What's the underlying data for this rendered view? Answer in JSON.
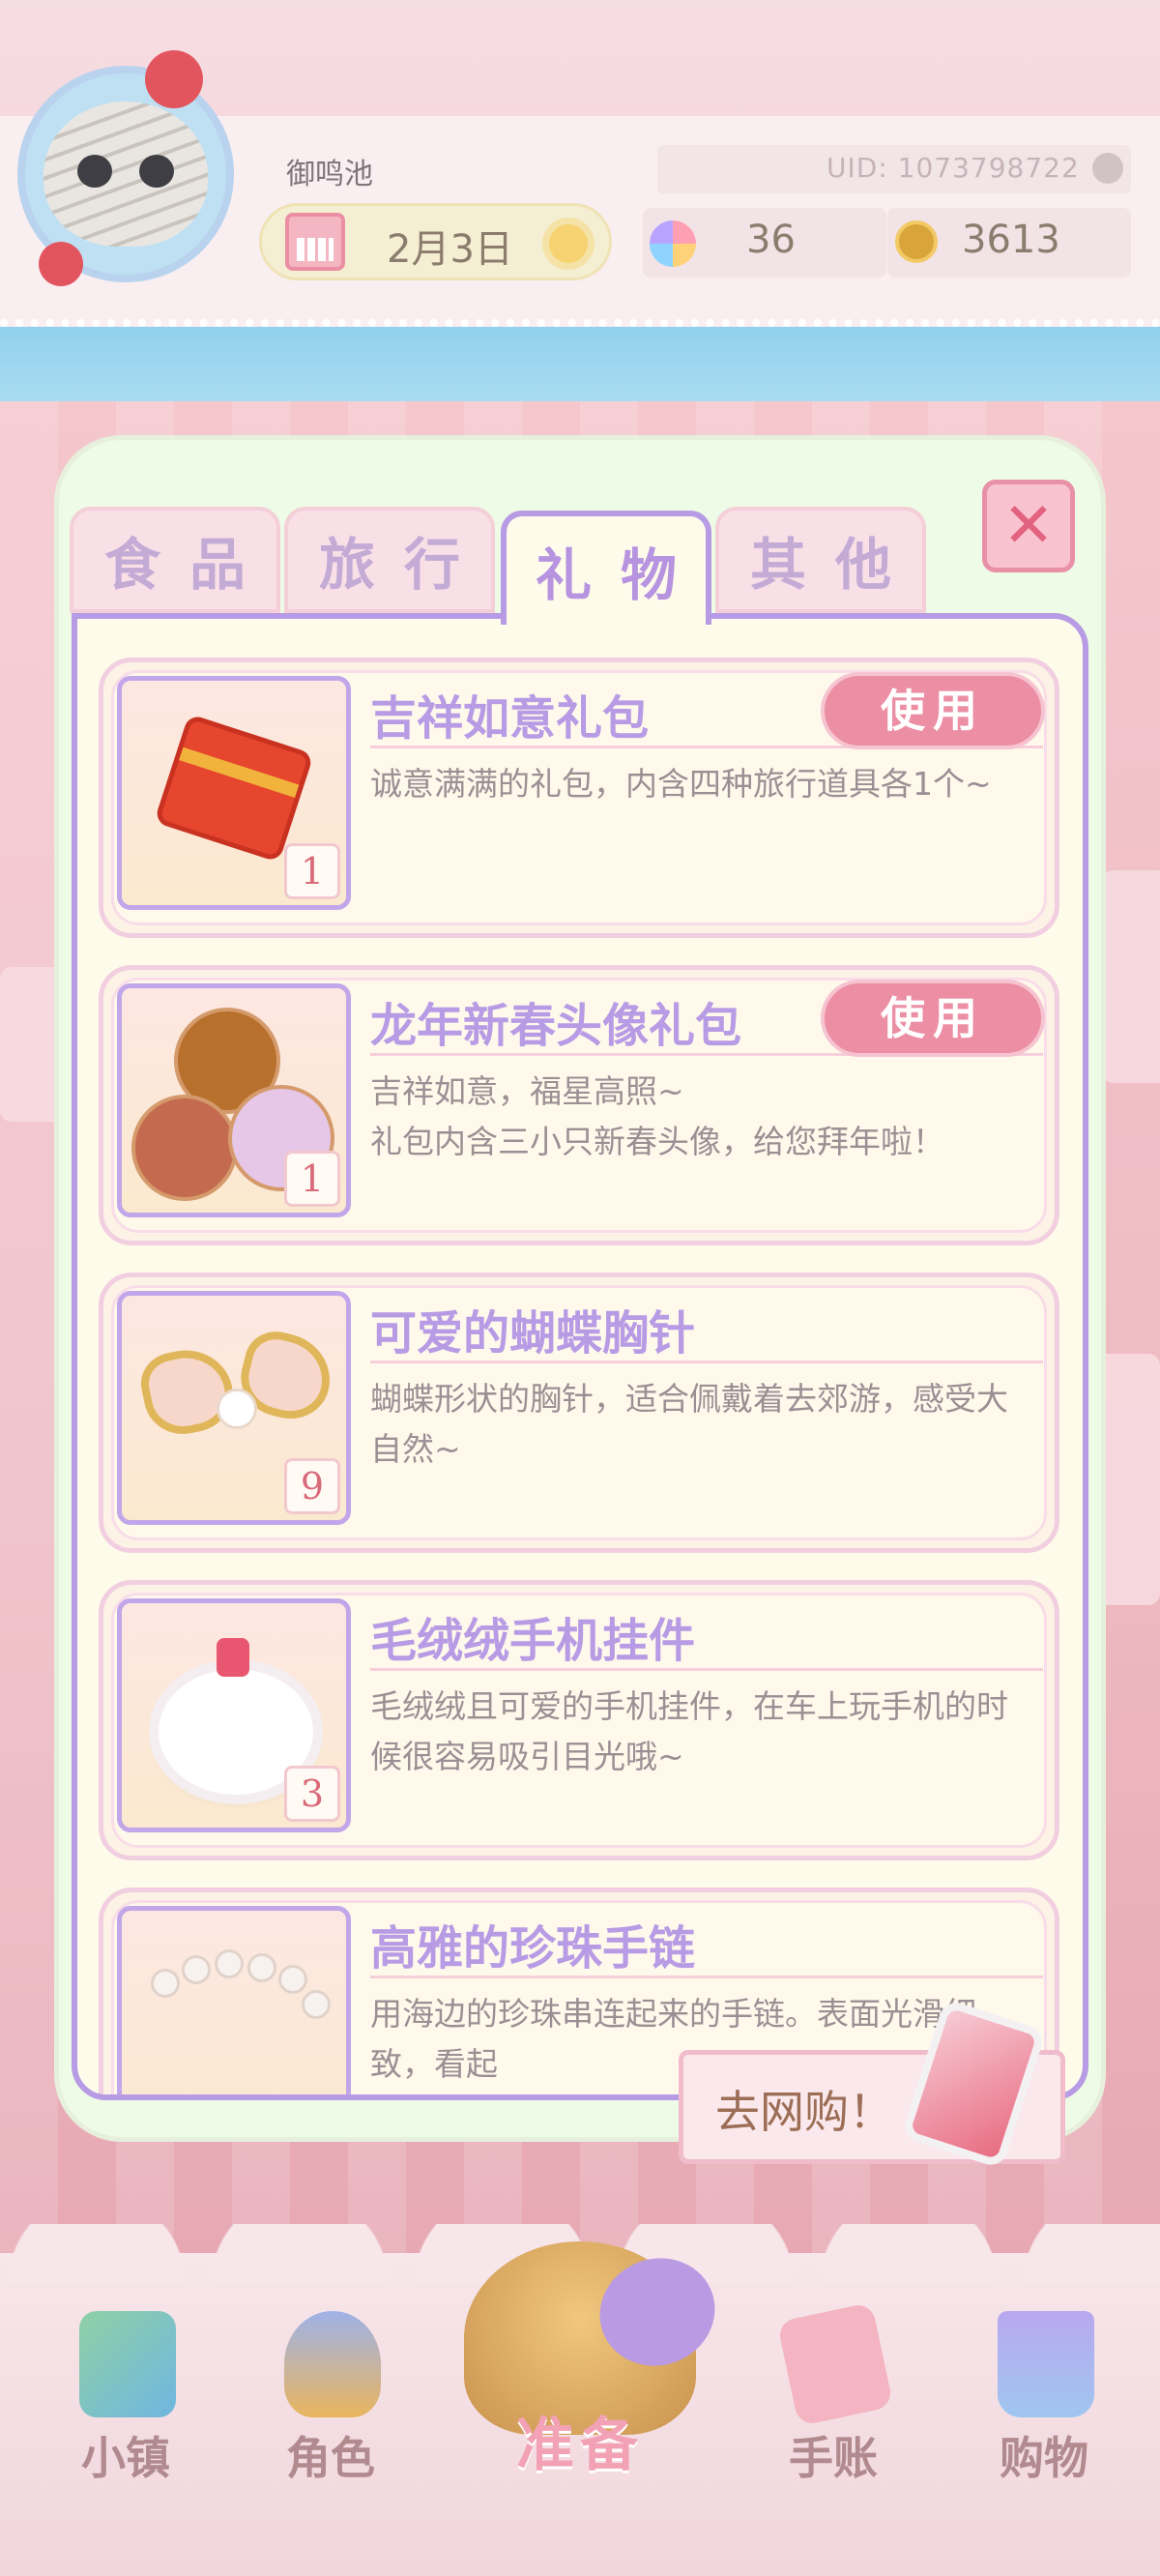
{
  "header": {
    "player_name": "御鸣池",
    "uid_label": "UID: 1073798722",
    "date": "2月3日",
    "flowers": "36",
    "coins": "3613"
  },
  "tabs": [
    {
      "label": "食品",
      "active": false
    },
    {
      "label": "旅行",
      "active": false
    },
    {
      "label": "礼物",
      "active": true
    },
    {
      "label": "其他",
      "active": false
    }
  ],
  "items": [
    {
      "title": "吉祥如意礼包",
      "desc": "诚意满满的礼包，内含四种旅行道具各1个~",
      "count": "1",
      "button": "使用",
      "icon": "red-packet-icon"
    },
    {
      "title": "龙年新春头像礼包",
      "desc": "吉祥如意，福星高照~\n礼包内含三小只新春头像，给您拜年啦！",
      "count": "1",
      "button": "使用",
      "icon": "avatar-pack-icon"
    },
    {
      "title": "可爱的蝴蝶胸针",
      "desc": "蝴蝶形状的胸针，适合佩戴着去郊游，感受大自然~",
      "count": "9",
      "icon": "butterfly-brooch-icon"
    },
    {
      "title": "毛绒绒手机挂件",
      "desc": "毛绒绒且可爱的手机挂件，在车上玩手机的时候很容易吸引目光哦~",
      "count": "3",
      "icon": "fluffy-charm-icon"
    },
    {
      "title": "高雅的珍珠手链",
      "desc": "用海边的珍珠串连起来的手链。表面光滑细致，看起",
      "icon": "pearl-bracelet-icon"
    }
  ],
  "netshop_label": "去网购！",
  "nav": [
    {
      "label": "小镇",
      "icon": "map-icon"
    },
    {
      "label": "角色",
      "icon": "character-icon"
    },
    {
      "label": "准备",
      "icon": "basket-icon",
      "active": true
    },
    {
      "label": "手账",
      "icon": "journal-icon"
    },
    {
      "label": "购物",
      "icon": "shopping-bag-icon"
    }
  ],
  "colors": {
    "accent_purple": "#b79be4",
    "accent_pink": "#ec8fa4",
    "panel_bg": "#eefbe6",
    "card_bg": "#fff9ec"
  }
}
